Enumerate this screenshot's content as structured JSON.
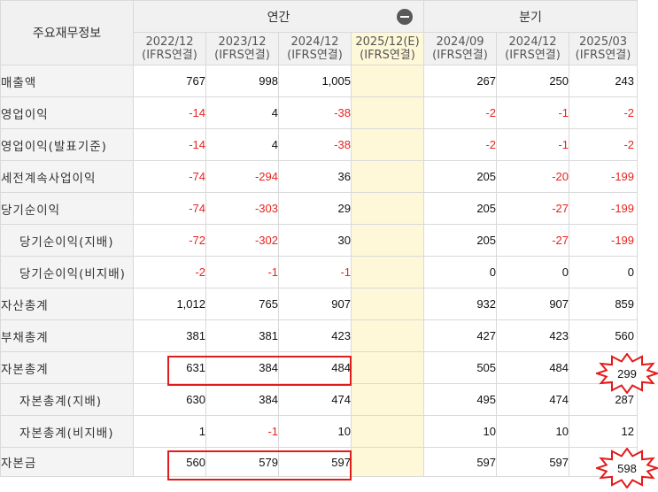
{
  "header": {
    "corner": "주요재무정보",
    "annual": "연간",
    "quarterly": "분기",
    "collapse_icon": "minus-circle-icon"
  },
  "periods": [
    {
      "date": "2022/12",
      "basis": "(IFRS연결)"
    },
    {
      "date": "2023/12",
      "basis": "(IFRS연결)"
    },
    {
      "date": "2024/12",
      "basis": "(IFRS연결)"
    },
    {
      "date": "2025/12(E)",
      "basis": "(IFRS연결)"
    },
    {
      "date": "2024/09",
      "basis": "(IFRS연결)"
    },
    {
      "date": "2024/12",
      "basis": "(IFRS연결)"
    },
    {
      "date": "2025/03",
      "basis": "(IFRS연결)"
    }
  ],
  "rows": [
    {
      "label": "매출액",
      "values": [
        "767",
        "998",
        "1,005",
        "",
        "267",
        "250",
        "243"
      ]
    },
    {
      "label": "영업이익",
      "values": [
        "-14",
        "4",
        "-38",
        "",
        "-2",
        "-1",
        "-2"
      ]
    },
    {
      "label": "영업이익(발표기준)",
      "values": [
        "-14",
        "4",
        "-38",
        "",
        "-2",
        "-1",
        "-2"
      ]
    },
    {
      "label": "세전계속사업이익",
      "values": [
        "-74",
        "-294",
        "36",
        "",
        "205",
        "-20",
        "-199"
      ]
    },
    {
      "label": "당기순이익",
      "values": [
        "-74",
        "-303",
        "29",
        "",
        "205",
        "-27",
        "-199"
      ]
    },
    {
      "label": "당기순이익(지배)",
      "values": [
        "-72",
        "-302",
        "30",
        "",
        "205",
        "-27",
        "-199"
      ]
    },
    {
      "label": "당기순이익(비지배)",
      "values": [
        "-2",
        "-1",
        "-1",
        "",
        "0",
        "0",
        "0"
      ]
    },
    {
      "label": "자산총계",
      "values": [
        "1,012",
        "765",
        "907",
        "",
        "932",
        "907",
        "859"
      ]
    },
    {
      "label": "부채총계",
      "values": [
        "381",
        "381",
        "423",
        "",
        "427",
        "423",
        "560"
      ]
    },
    {
      "label": "자본총계",
      "values": [
        "631",
        "384",
        "484",
        "",
        "505",
        "484",
        "299"
      ]
    },
    {
      "label": "자본총계(지배)",
      "values": [
        "630",
        "384",
        "474",
        "",
        "495",
        "474",
        "287"
      ]
    },
    {
      "label": "자본총계(비지배)",
      "values": [
        "1",
        "-1",
        "10",
        "",
        "10",
        "10",
        "12"
      ]
    },
    {
      "label": "자본금",
      "values": [
        "560",
        "579",
        "597",
        "",
        "597",
        "597",
        "598"
      ]
    }
  ],
  "highlights": {
    "equity_total_callout": "299",
    "capital_callout": "598"
  },
  "colors": {
    "negative": "#e8231f",
    "estimate_bg": "#fff8d8",
    "highlight_box": "#e21b1b",
    "header_bg": "#f1f1f1"
  }
}
